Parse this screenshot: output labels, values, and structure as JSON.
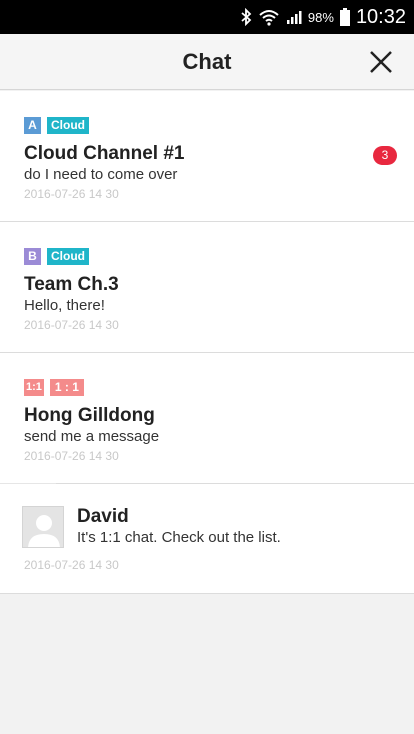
{
  "status_bar": {
    "battery_percent": "98%",
    "time": "10:32",
    "icons": [
      "bluetooth-icon",
      "wifi-icon",
      "signal-icon",
      "battery-icon"
    ]
  },
  "header": {
    "title": "Chat",
    "close_icon": "close-icon"
  },
  "chats": [
    {
      "tags": [
        {
          "text": "A",
          "color": "#5b9bd5"
        },
        {
          "text": "Cloud",
          "color": "#1fb5c9"
        }
      ],
      "name": "Cloud Channel #1",
      "message": "do I need to come over",
      "date": "2016-07-26 14 30",
      "unread": "3"
    },
    {
      "tags": [
        {
          "text": "B",
          "color": "#9b8bd6"
        },
        {
          "text": "Cloud",
          "color": "#1fb5c9"
        }
      ],
      "name": "Team Ch.3",
      "message": "Hello, there!",
      "date": "2016-07-26 14 30"
    },
    {
      "tags": [
        {
          "text": "1:1",
          "color": "#f48b8b"
        },
        {
          "text": "1 : 1",
          "color": "#f48b8b"
        }
      ],
      "name": "Hong Gilldong",
      "message": "send me a message",
      "date": "2016-07-26 14 30"
    }
  ],
  "person": {
    "name": "David",
    "message": "It's 1:1 chat. Check out the list.",
    "date": "2016-07-26 14 30"
  },
  "colors": {
    "badge": "#e8283f",
    "date_text": "#c8c8c8",
    "background": "#f2f2f2"
  }
}
